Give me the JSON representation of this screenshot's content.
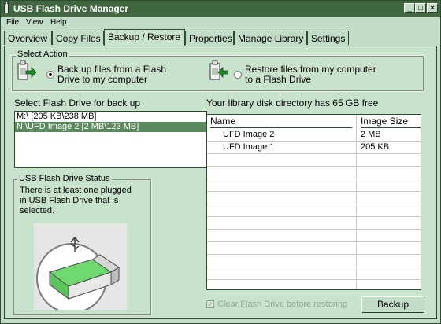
{
  "window": {
    "title": "USB Flash Drive Manager",
    "min_glyph": "_",
    "max_glyph": "□",
    "close_glyph": "×"
  },
  "menu": [
    "File",
    "View",
    "Help"
  ],
  "tabs": [
    {
      "label": "Overview",
      "active": false
    },
    {
      "label": "Copy Files",
      "active": false
    },
    {
      "label": "Backup / Restore",
      "active": true
    },
    {
      "label": "Properties",
      "active": false
    },
    {
      "label": "Manage Library",
      "active": false
    },
    {
      "label": "Settings",
      "active": false
    }
  ],
  "select_action": {
    "group_label": "Select Action",
    "backup": {
      "line1": "Back up files from a Flash",
      "line2": "Drive to my computer",
      "selected": true
    },
    "restore": {
      "line1": "Restore files from my computer",
      "line2": "to a Flash Drive",
      "selected": false
    }
  },
  "drive_select": {
    "label": "Select Flash Drive for back up",
    "items": [
      {
        "text": "M:\\ [205 KB\\238 MB]",
        "selected": false
      },
      {
        "text": "N:\\UFD Image 2 [2 MB\\123 MB]",
        "selected": true
      }
    ]
  },
  "status": {
    "group_label": "USB Flash Drive Status",
    "line1": "There is at least one plugged",
    "line2": "in USB Flash Drive that is",
    "line3": "selected."
  },
  "library": {
    "info": "Your library disk directory has 65 GB free",
    "columns": [
      "Name",
      "Image Size"
    ],
    "rows": [
      {
        "name": "UFD Image 2",
        "size": "2 MB"
      },
      {
        "name": "UFD Image 1",
        "size": "205 KB"
      }
    ]
  },
  "clear_option": {
    "label": "Clear Flash Drive before restoring",
    "checked": true,
    "enabled": false
  },
  "backup_button": "Backup",
  "colors": {
    "titlebar": "#40673f",
    "panel": "#c9e2cc",
    "selection": "#5a8a5e",
    "usb_green": "#6fd86f"
  }
}
